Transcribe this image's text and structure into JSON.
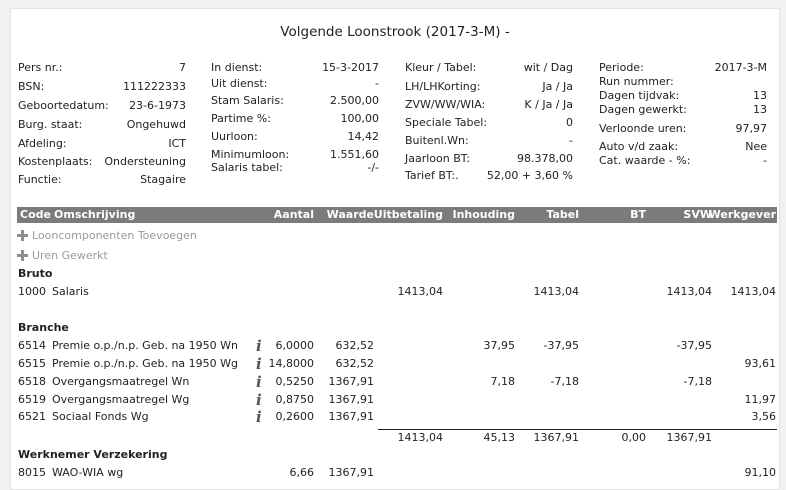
{
  "title": "Volgende Loonstrook (2017-3-M) -",
  "col1": [
    {
      "k": "Pers nr.:",
      "v": "7"
    },
    {
      "k": "BSN:",
      "v": "111222333"
    },
    {
      "k": "Geboortedatum:",
      "v": "23-6-1973"
    },
    {
      "k": "Burg. staat:",
      "v": "Ongehuwd"
    },
    {
      "k": "Afdeling:",
      "v": "ICT"
    },
    {
      "k": "Kostenplaats:",
      "v": "Ondersteuning"
    },
    {
      "k": "Functie:",
      "v": "Stagaire"
    }
  ],
  "col2": [
    {
      "k": "In dienst:",
      "v": "15-3-2017"
    },
    {
      "k": "Uit dienst:",
      "v": "-"
    },
    {
      "k": "Stam Salaris:",
      "v": "2.500,00"
    },
    {
      "k": "Partime %:",
      "v": "100,00"
    },
    {
      "k": "Uurloon:",
      "v": "14,42"
    },
    {
      "k": "Minimumloon:",
      "v": "1.551,60"
    },
    {
      "k": "Salaris tabel:",
      "v": "-/-"
    }
  ],
  "col3": [
    {
      "k": "Kleur / Tabel:",
      "v": "wit / Dag"
    },
    {
      "k": "LH/LHKorting:",
      "v": "Ja / Ja"
    },
    {
      "k": "ZVW/WW/WIA:",
      "v": "K / Ja / Ja"
    },
    {
      "k": "Speciale Tabel:",
      "v": "0"
    },
    {
      "k": "Buitenl.Wn:",
      "v": "-"
    },
    {
      "k": "Jaarloon BT:",
      "v": "98.378,00"
    },
    {
      "k": "Tarief BT:.",
      "v": "52,00 + 3,60 %"
    }
  ],
  "col4": [
    {
      "k": "Periode:",
      "v": "2017-3-M"
    },
    {
      "k": "Run nummer:",
      "v": ""
    },
    {
      "k": "Dagen tijdvak:",
      "v": "13"
    },
    {
      "k": "Dagen gewerkt:",
      "v": "13"
    },
    {
      "k": "Verloonde uren:",
      "v": "97,97"
    },
    {
      "k": "Auto v/d zaak:",
      "v": "Nee"
    },
    {
      "k": "Cat. waarde - %:",
      "v": "-"
    }
  ],
  "grid_headers": {
    "code": "Code",
    "oms": "Omschrijving",
    "aantal": "Aantal",
    "waarde": "Waarde",
    "uitbetaling": "Uitbetaling",
    "inhouding": "Inhouding",
    "tabel": "Tabel",
    "bt": "BT",
    "svw": "SVW",
    "werkgever": "Werkgever"
  },
  "actions": {
    "add_components": "Looncomponenten Toevoegen",
    "hours_worked": "Uren Gewerkt"
  },
  "sections": {
    "bruto": "Bruto",
    "branche": "Branche",
    "werknemer": "Werknemer Verzekering"
  },
  "rows": {
    "r1000": {
      "code": "1000",
      "oms": "Salaris",
      "aantal": "",
      "waarde": "",
      "uitbetaling": "1413,04",
      "inhouding": "",
      "tabel": "1413,04",
      "bt": "",
      "svw": "1413,04",
      "werkgever": "1413,04"
    },
    "r6514": {
      "code": "6514",
      "oms": "Premie o.p./n.p. Geb. na 1950 Wn",
      "aantal": "6,0000",
      "waarde": "632,52",
      "uitbetaling": "",
      "inhouding": "37,95",
      "tabel": "-37,95",
      "bt": "",
      "svw": "-37,95",
      "werkgever": ""
    },
    "r6515": {
      "code": "6515",
      "oms": "Premie o.p./n.p. Geb. na 1950 Wg",
      "aantal": "14,8000",
      "waarde": "632,52",
      "uitbetaling": "",
      "inhouding": "",
      "tabel": "",
      "bt": "",
      "svw": "",
      "werkgever": "93,61"
    },
    "r6518": {
      "code": "6518",
      "oms": "Overgangsmaatregel Wn",
      "aantal": "0,5250",
      "waarde": "1367,91",
      "uitbetaling": "",
      "inhouding": "7,18",
      "tabel": "-7,18",
      "bt": "",
      "svw": "-7,18",
      "werkgever": ""
    },
    "r6519": {
      "code": "6519",
      "oms": "Overgangsmaatregel Wg",
      "aantal": "0,8750",
      "waarde": "1367,91",
      "uitbetaling": "",
      "inhouding": "",
      "tabel": "",
      "bt": "",
      "svw": "",
      "werkgever": "11,97"
    },
    "r6521": {
      "code": "6521",
      "oms": "Sociaal Fonds Wg",
      "aantal": "0,2600",
      "waarde": "1367,91",
      "uitbetaling": "",
      "inhouding": "",
      "tabel": "",
      "bt": "",
      "svw": "",
      "werkgever": "3,56"
    },
    "totals": {
      "uitbetaling": "1413,04",
      "inhouding": "45,13",
      "tabel": "1367,91",
      "bt": "0,00",
      "svw": "1367,91"
    },
    "r8015": {
      "code": "8015",
      "oms": "WAO-WIA wg",
      "aantal": "6,66",
      "waarde": "1367,91",
      "uitbetaling": "",
      "inhouding": "",
      "tabel": "",
      "bt": "",
      "svw": "",
      "werkgever": "91,10"
    }
  },
  "icons": {
    "info": "i",
    "add": "plus-icon"
  }
}
